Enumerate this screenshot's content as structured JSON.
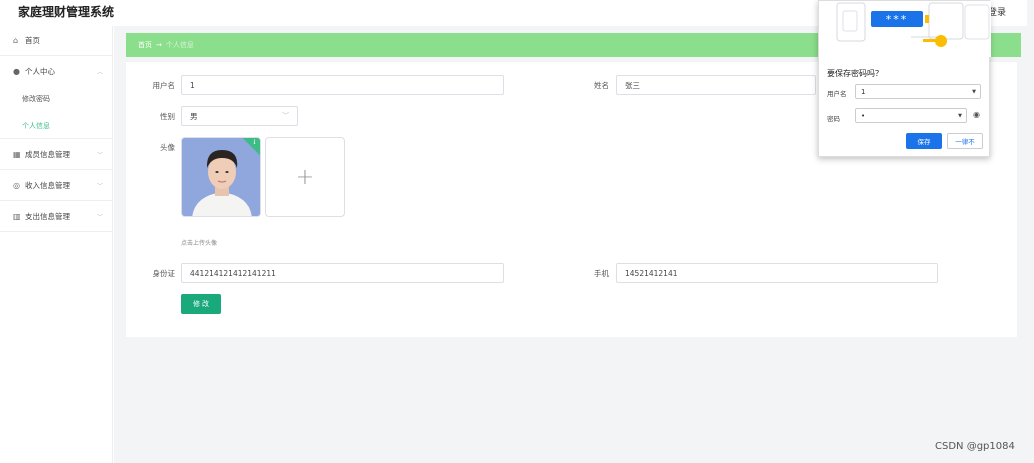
{
  "header": {
    "title": "家庭理财管理系统",
    "login": "登录"
  },
  "sidebar": {
    "items": [
      {
        "icon": "home-icon",
        "label": "首页"
      },
      {
        "icon": "user-icon",
        "label": "个人中心"
      },
      {
        "icon": "list-icon",
        "label": "成员信息管理"
      },
      {
        "icon": "money-icon",
        "label": "收入信息管理"
      },
      {
        "icon": "chart-icon",
        "label": "支出信息管理"
      }
    ],
    "subitems": [
      {
        "label": "修改密码"
      },
      {
        "label": "个人信息"
      }
    ]
  },
  "breadcrumb": {
    "home": "首页",
    "arrow": "→",
    "current": "个人信息"
  },
  "form": {
    "username_label": "用户名",
    "username_value": "1",
    "name_label": "姓名",
    "name_value": "张三",
    "gender_label": "性别",
    "gender_value": "男",
    "avatar_label": "头像",
    "upload_plus": "+",
    "upload_hint": "点击上传头像",
    "idcard_label": "身份证",
    "idcard_value": "441214121412141211",
    "phone_label": "手机",
    "phone_value": "14521412141",
    "submit": "修 改"
  },
  "popup": {
    "stars": "***",
    "title": "要保存密码吗？",
    "username_label": "用户名",
    "username_value": "1",
    "password_label": "密码",
    "password_value": "•",
    "save": "保存",
    "never": "一律不"
  },
  "watermark": "CSDN @gp1084",
  "colors": {
    "accent": "#3dbc86",
    "breadcrumb": "#8bde8b",
    "button": "#1aa97b",
    "chrome_blue": "#1a73e8"
  }
}
